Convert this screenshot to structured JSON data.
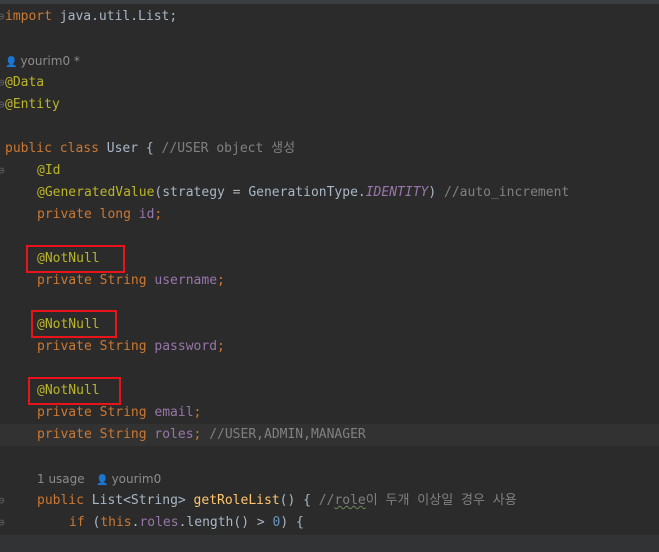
{
  "code": {
    "import_kw": "import",
    "import_path": " java.util.List;",
    "author_hint": "yourim0 *",
    "ann_data": "@Data",
    "ann_entity": "@Entity",
    "class_kw": "public class",
    "class_name": " User { ",
    "class_comment": "//USER object 생성",
    "ann_id": "@Id",
    "ann_generated": "@GeneratedValue",
    "generated_args_open": "(strategy = GenerationType.",
    "identity": "IDENTITY",
    "generated_args_close": ") ",
    "generated_comment": "//auto_increment",
    "private_long": "private long ",
    "field_id": "id",
    "semicolon": ";",
    "notnull": "@NotNull",
    "private_string": "private String ",
    "field_username": "username",
    "field_password": "password",
    "field_email": "email",
    "field_roles": "roles",
    "roles_comment": "//USER,ADMIN,MANAGER",
    "usage_hint": "1 usage",
    "usage_author": "yourim0",
    "method_kw": "public ",
    "method_type": "List<String> ",
    "method_name": "getRoleList",
    "method_sig": "() { ",
    "method_comment_pre": "//",
    "method_comment_typo": "role",
    "method_comment_post": "이 두개 이상일 경우 사용",
    "if_kw": "if ",
    "if_open": "(",
    "this_kw": "this",
    "dot": ".",
    "roles_ref": "roles",
    "length_call": ".length() > ",
    "zero": "0",
    "if_close": ") {"
  },
  "colors": {
    "background": "#2b2b2b",
    "keyword": "#cc7832",
    "annotation": "#bbb529",
    "field": "#9876aa",
    "comment": "#808080",
    "method": "#ffc66d",
    "highlight_box": "#e8141a"
  }
}
